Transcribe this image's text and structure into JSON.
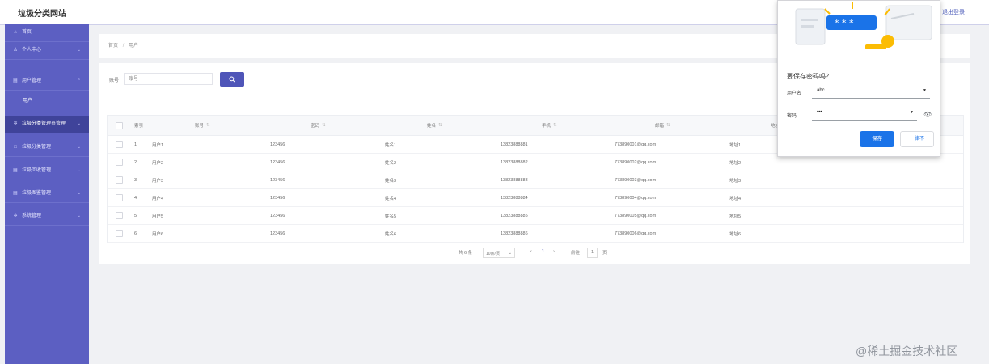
{
  "header": {
    "site_title": "垃圾分类网站",
    "logout": "退出登录"
  },
  "sidebar": {
    "items": [
      {
        "label": "首页",
        "icon": "home-icon",
        "arrow": false
      },
      {
        "label": "个人中心",
        "icon": "user-icon",
        "arrow": true
      },
      {
        "label": "用户管理",
        "icon": "users-icon",
        "arrow": true
      },
      {
        "label": "用户",
        "sub": true
      },
      {
        "label": "垃圾分类管理员管理",
        "icon": "gear-icon",
        "arrow": true,
        "active": true
      },
      {
        "label": "垃圾分类管理",
        "icon": "folder-icon",
        "arrow": true
      },
      {
        "label": "垃圾回收管理",
        "icon": "list-icon",
        "arrow": true
      },
      {
        "label": "垃圾图鉴管理",
        "icon": "book-icon",
        "arrow": true
      },
      {
        "label": "系统管理",
        "icon": "settings-icon",
        "arrow": true
      }
    ]
  },
  "breadcrumb": {
    "home": "首页",
    "separator": "/",
    "current": "用户"
  },
  "search": {
    "label": "账号",
    "placeholder": "账号",
    "button_icon": "search-icon"
  },
  "table": {
    "columns": [
      "索引",
      "账号",
      "密码",
      "姓名",
      "手机",
      "邮箱",
      "地址"
    ],
    "rows": [
      [
        "1",
        "用户1",
        "123456",
        "姓名1",
        "13823888881",
        "773890001@qq.com",
        "地址1"
      ],
      [
        "2",
        "用户2",
        "123456",
        "姓名2",
        "13823888882",
        "773890002@qq.com",
        "地址2"
      ],
      [
        "3",
        "用户3",
        "123456",
        "姓名3",
        "13823888883",
        "773890003@qq.com",
        "地址3"
      ],
      [
        "4",
        "用户4",
        "123456",
        "姓名4",
        "13823888884",
        "773890004@qq.com",
        "地址4"
      ],
      [
        "5",
        "用户5",
        "123456",
        "姓名5",
        "13823888885",
        "773890005@qq.com",
        "地址5"
      ],
      [
        "6",
        "用户6",
        "123456",
        "姓名6",
        "13823888886",
        "773890006@qq.com",
        "地址6"
      ]
    ]
  },
  "pagination": {
    "total": "共 6 条",
    "page_size": "10条/页",
    "prev": "‹",
    "current_page": "1",
    "next": "›",
    "goto": "前往",
    "goto_page": "1",
    "page_unit": "页"
  },
  "password_popup": {
    "title": "要保存密码吗？",
    "username_label": "用户名",
    "username_value": "abc",
    "password_label": "密码",
    "password_value": "•••",
    "save": "保存",
    "never": "一律不",
    "masked_text": "* * *"
  },
  "watermark": "@稀土掘金技术社区",
  "colors": {
    "sidebar": "#5c5fc2",
    "accent": "#4f55b8",
    "save_button": "#1a73e8"
  }
}
